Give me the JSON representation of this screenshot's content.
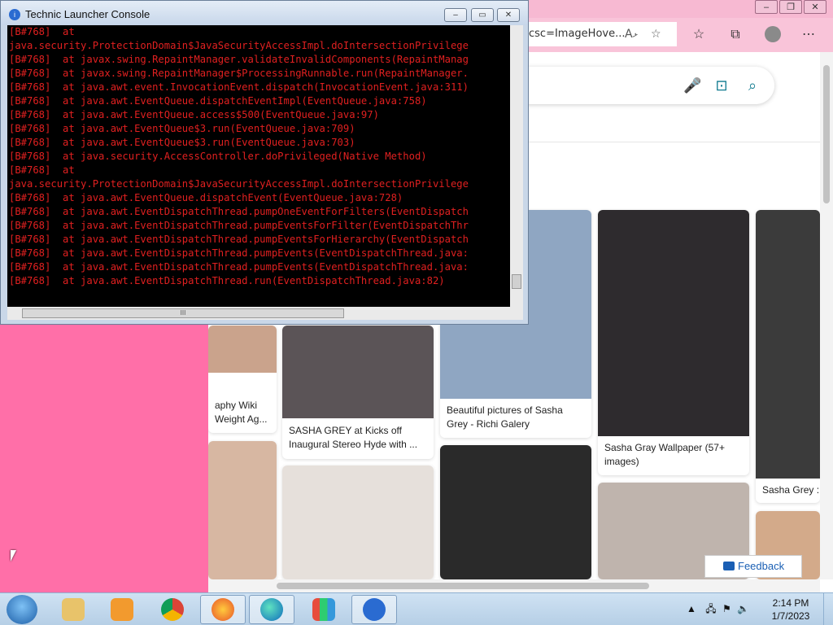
{
  "browser": {
    "address_fragment": "csc=ImageHove...",
    "read_aloud_glyph": "Aޅ",
    "window_buttons": [
      "–",
      "❐",
      "✕"
    ]
  },
  "results": [
    {
      "caption": "aphy Wiki\nWeight Ag...",
      "color": "#caa38c"
    },
    {
      "caption": "SASHA GREY at Kicks off\nInaugural Stereo Hyde with ...",
      "color": "#5b5457"
    },
    {
      "caption": "Beautiful pictures of Sasha\nGrey - Richi Galery",
      "color": "#8fa6c2"
    },
    {
      "caption": "Sasha Gray Wallpaper (57+\nimages)",
      "color": "#2e2b2e"
    },
    {
      "caption": "Sasha Grey :",
      "color": "#3b3b3b"
    }
  ],
  "feedback_label": "Feedback",
  "console": {
    "title": "Technic Launcher Console",
    "lines": [
      "[B#768]  at",
      "java.security.ProtectionDomain$JavaSecurityAccessImpl.doIntersectionPrivilege",
      "[B#768]  at javax.swing.RepaintManager.validateInvalidComponents(RepaintManag",
      "[B#768]  at javax.swing.RepaintManager$ProcessingRunnable.run(RepaintManager.",
      "[B#768]  at java.awt.event.InvocationEvent.dispatch(InvocationEvent.java:311)",
      "[B#768]  at java.awt.EventQueue.dispatchEventImpl(EventQueue.java:758)",
      "[B#768]  at java.awt.EventQueue.access$500(EventQueue.java:97)",
      "[B#768]  at java.awt.EventQueue$3.run(EventQueue.java:709)",
      "[B#768]  at java.awt.EventQueue$3.run(EventQueue.java:703)",
      "[B#768]  at java.security.AccessController.doPrivileged(Native Method)",
      "[B#768]  at",
      "java.security.ProtectionDomain$JavaSecurityAccessImpl.doIntersectionPrivilege",
      "[B#768]  at java.awt.EventQueue.dispatchEvent(EventQueue.java:728)",
      "[B#768]  at java.awt.EventDispatchThread.pumpOneEventForFilters(EventDispatch",
      "[B#768]  at java.awt.EventDispatchThread.pumpEventsForFilter(EventDispatchThr",
      "[B#768]  at java.awt.EventDispatchThread.pumpEventsForHierarchy(EventDispatch",
      "[B#768]  at java.awt.EventDispatchThread.pumpEvents(EventDispatchThread.java:",
      "[B#768]  at java.awt.EventDispatchThread.pumpEvents(EventDispatchThread.java:",
      "[B#768]  at java.awt.EventDispatchThread.run(EventDispatchThread.java:82)"
    ],
    "text_color": "#e02020",
    "hscroll_grip": "III"
  },
  "taskbar": {
    "time": "2:14 PM",
    "date": "1/7/2023"
  }
}
